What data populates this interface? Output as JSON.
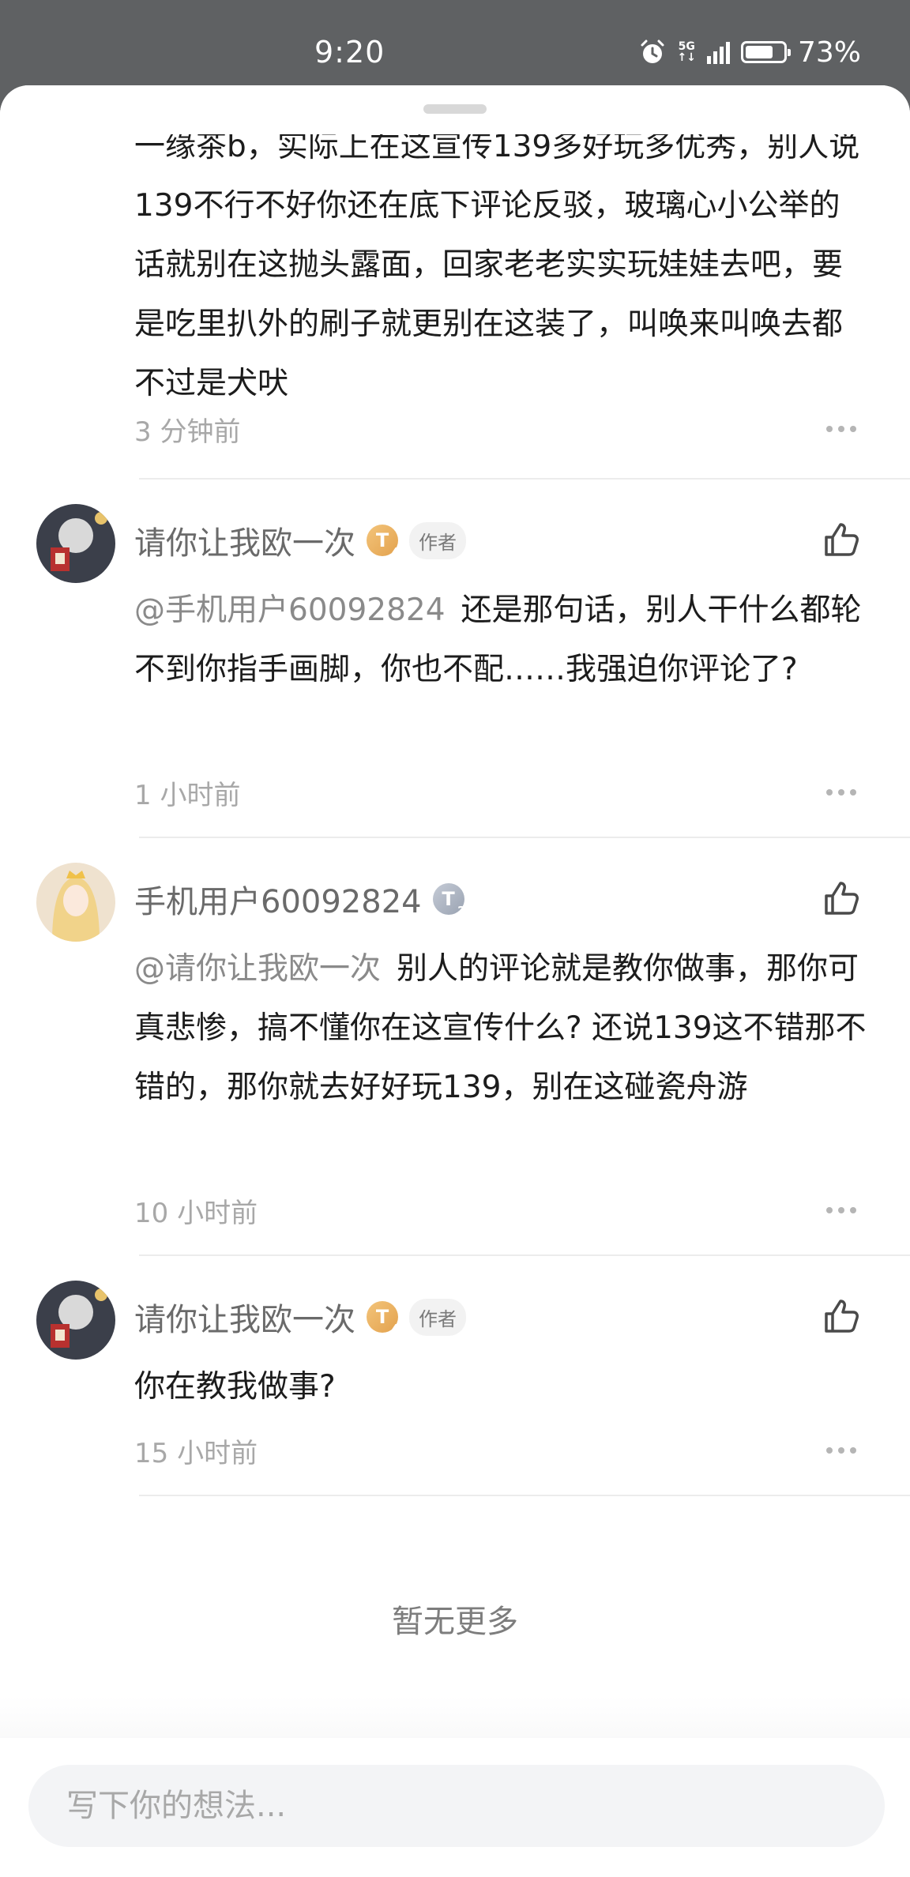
{
  "status_bar": {
    "time": "9:20",
    "network": "5G",
    "battery": "73%",
    "battery_level": 0.73,
    "icons": [
      "alarm-icon",
      "signal-icon",
      "battery-icon"
    ]
  },
  "comments": [
    {
      "text_partial": "一缘茶b，实际上在这宣传139多好玩多优秀，别人说139不行不好你还在底下评论反驳，玻璃心小公举的话就别在这抛头露面，回家老老实实玩娃娃去吧，要是吃里扒外的刷子就更别在这装了，叫唤来叫唤去都不过是犬吠",
      "time": "3 分钟前"
    },
    {
      "author": "请你让我欧一次",
      "level": "T",
      "level_num": "4",
      "tag": "作者",
      "mention": "@手机用户60092824",
      "text": "还是那句话，别人干什么都轮不到你指手画脚，你也不配……我强迫你评论了?",
      "time": "1 小时前"
    },
    {
      "author": "手机用户60092824",
      "level": "T",
      "level_num": "2",
      "mention": "@请你让我欧一次",
      "text": "别人的评论就是教你做事，那你可真悲惨，搞不懂你在这宣传什么? 还说139这不错那不错的，那你就去好好玩139，别在这碰瓷舟游",
      "time": "10 小时前"
    },
    {
      "author": "请你让我欧一次",
      "level": "T",
      "level_num": "4",
      "tag": "作者",
      "text": "你在教我做事?",
      "time": "15 小时前"
    }
  ],
  "footer": {
    "no_more": "暂无更多"
  },
  "input": {
    "placeholder": "写下你的想法..."
  },
  "colors": {
    "status_bar_bg": "#5f6163",
    "gold_badge": "#e3a24e",
    "gray_badge": "#9aa3b2"
  }
}
